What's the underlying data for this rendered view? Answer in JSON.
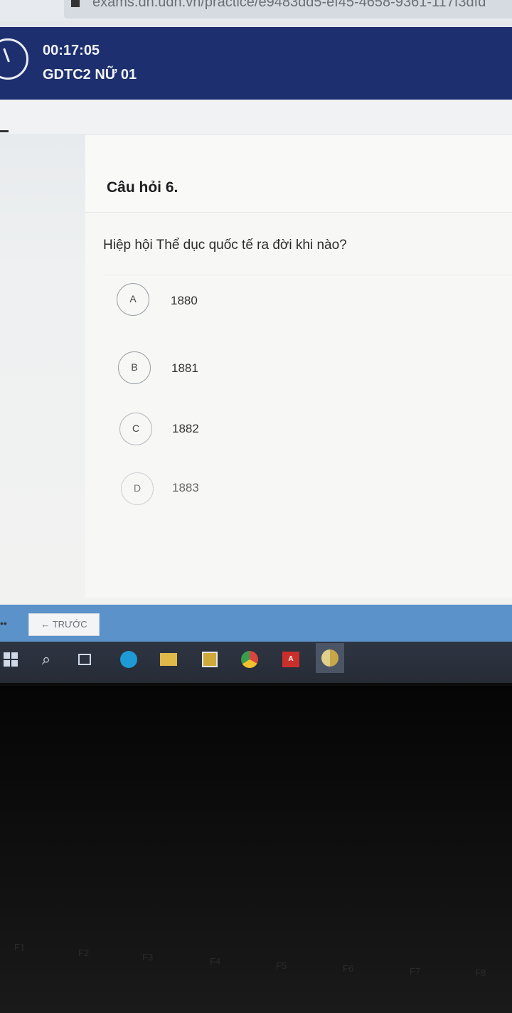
{
  "browser": {
    "url_fragment": "exams.dh.udn.vn/practice/e9483dd5-ef45-4658-9361-117f3dfd"
  },
  "header": {
    "timer": "00:17:05",
    "course": "GDTC2 NỮ 01"
  },
  "question": {
    "number_label": "Câu hỏi 6.",
    "text": "Hiệp hội Thể dục quốc tế ra đời khi nào?",
    "options": [
      {
        "letter": "A",
        "value": "1880"
      },
      {
        "letter": "B",
        "value": "1881"
      },
      {
        "letter": "C",
        "value": "1882"
      },
      {
        "letter": "D",
        "value": "1883"
      }
    ]
  },
  "nav": {
    "prev_label": "← TRƯỚC"
  },
  "taskbar": {
    "apps": [
      "windows-start",
      "search",
      "task-view",
      "edge",
      "file-explorer",
      "store",
      "chrome",
      "acrobat",
      "chrome-active"
    ]
  },
  "keyboard": {
    "fkeys": [
      "F1",
      "F2",
      "F3",
      "F4",
      "F5",
      "F6",
      "F7",
      "F8"
    ]
  }
}
